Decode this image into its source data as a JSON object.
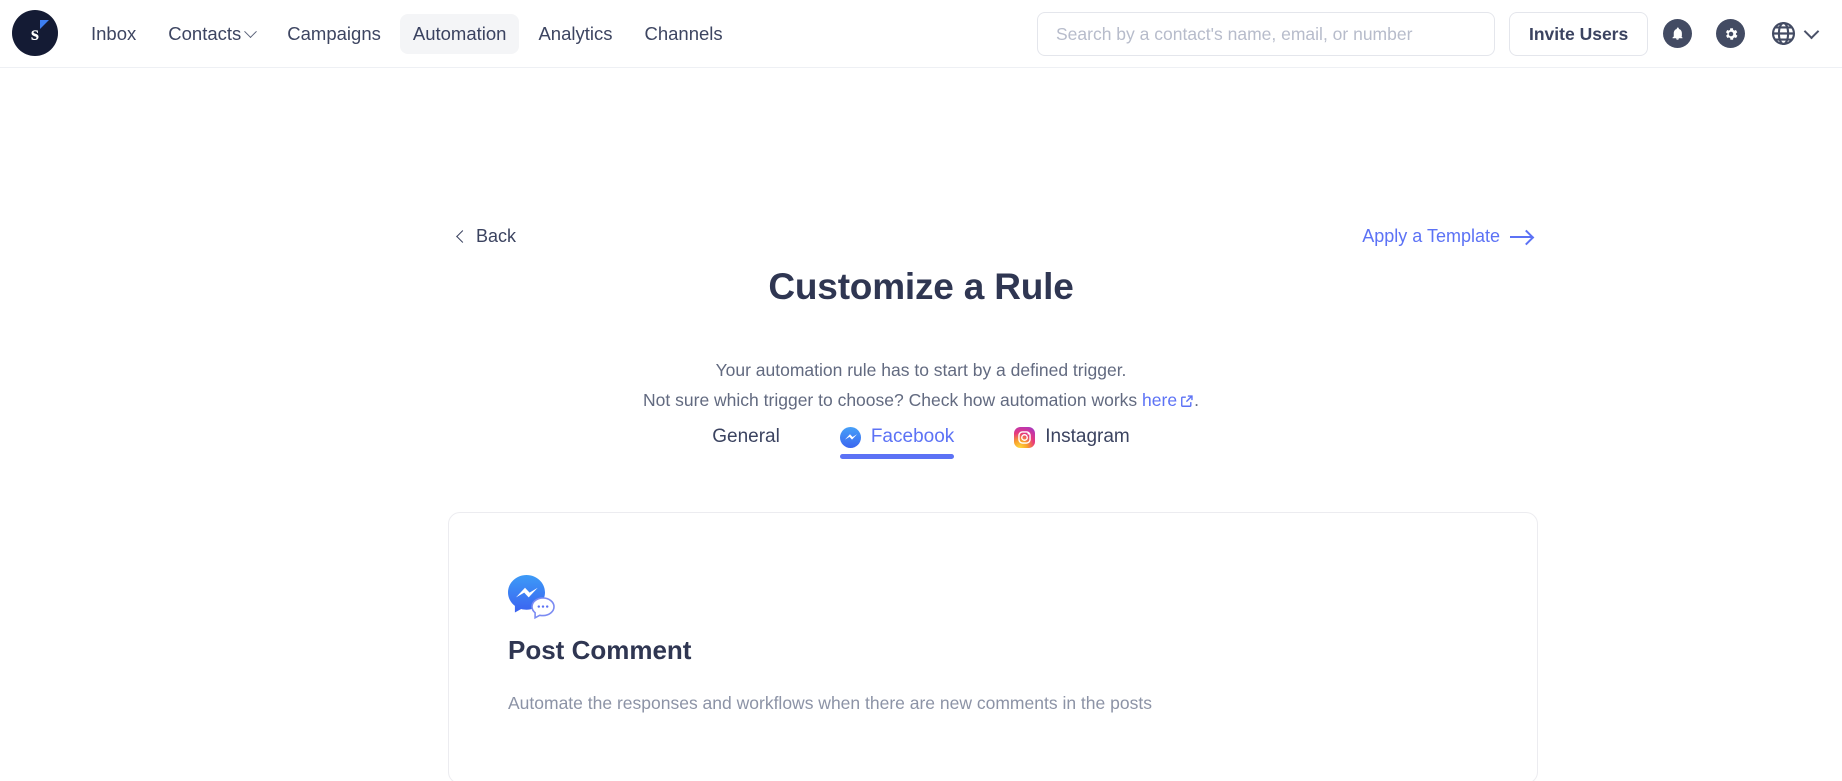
{
  "header": {
    "logo_letter": "s",
    "logo_name": "brand-logo",
    "nav": [
      {
        "label": "Inbox",
        "active": false,
        "has_caret": false
      },
      {
        "label": "Contacts",
        "active": false,
        "has_caret": true
      },
      {
        "label": "Campaigns",
        "active": false,
        "has_caret": false
      },
      {
        "label": "Automation",
        "active": true,
        "has_caret": false
      },
      {
        "label": "Analytics",
        "active": false,
        "has_caret": false
      },
      {
        "label": "Channels",
        "active": false,
        "has_caret": false
      }
    ],
    "search": {
      "value": "",
      "placeholder": "Search by a contact's name, email, or number"
    },
    "invite_label": "Invite Users",
    "icons": {
      "bell": "bell-icon",
      "gear": "gear-icon",
      "globe": "globe-icon",
      "caret": "chevron-down-icon"
    }
  },
  "page": {
    "back_label": "Back",
    "apply_template_label": "Apply a Template",
    "title": "Customize a Rule",
    "subtitle_line1": "Your automation rule has to start by a defined trigger.",
    "subtitle_line2_pre": "Not sure which trigger to choose? Check how automation works ",
    "subtitle_link": "here",
    "subtitle_line2_post": "."
  },
  "tabs": [
    {
      "label": "General",
      "active": false,
      "icon": "none"
    },
    {
      "label": "Facebook",
      "active": true,
      "icon": "messenger-icon"
    },
    {
      "label": "Instagram",
      "active": false,
      "icon": "instagram-icon"
    }
  ],
  "trigger_card": {
    "icon": "messenger-comment-icon",
    "title": "Post Comment",
    "description": "Automate the responses and workflows when there are new comments in the posts"
  },
  "colors": {
    "accent": "#5c72f5",
    "text_dark": "#2f3652",
    "text_muted": "#8c93a6",
    "nav_active_bg": "#f4f5f7",
    "border": "#ececf0",
    "logo_bg": "#141b34"
  }
}
